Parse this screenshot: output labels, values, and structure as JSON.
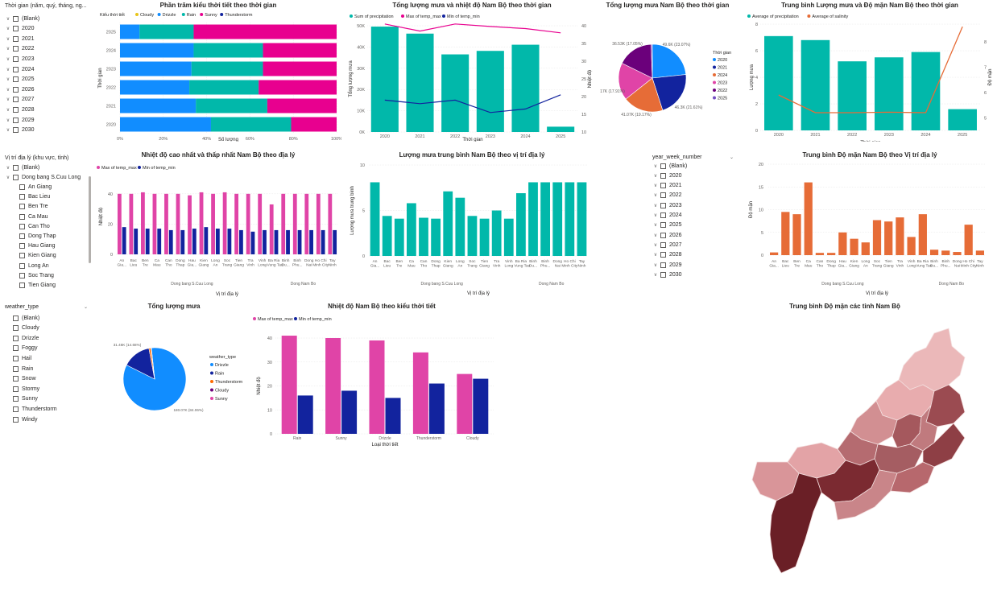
{
  "slicers": {
    "time": {
      "title": "Thời gian (năm, quý, tháng, ng...",
      "items": [
        "(Blank)",
        "2020",
        "2021",
        "2022",
        "2023",
        "2024",
        "2025",
        "2026",
        "2027",
        "2028",
        "2029",
        "2030"
      ]
    },
    "region": {
      "title": "Vị trí địa lý (khu vực, tỉnh)",
      "items": [
        "(Blank)",
        "Dong bang S.Cuu Long",
        "An Giang",
        "Bac Lieu",
        "Ben Tre",
        "Ca Mau",
        "Can Tho",
        "Dong Thap",
        "Hau Giang",
        "Kien Giang",
        "Long An",
        "Soc Trang",
        "Tien Giang"
      ]
    },
    "weather": {
      "title": "weather_type",
      "items": [
        "(Blank)",
        "Cloudy",
        "Drizzle",
        "Foggy",
        "Hail",
        "Rain",
        "Snow",
        "Stormy",
        "Sunny",
        "Thunderstorm",
        "Windy"
      ]
    },
    "week": {
      "title": "year_week_number",
      "items": [
        "(Blank)",
        "2020",
        "2021",
        "2022",
        "2023",
        "2024",
        "2025",
        "2026",
        "2027",
        "2028",
        "2029",
        "2030"
      ]
    }
  },
  "colors": {
    "teal": "#01b8aa",
    "navy": "#12239e",
    "magenta": "#e8008f",
    "pink": "#e044a7",
    "orange": "#e66c37",
    "blue": "#118dff",
    "purple": "#6b007b",
    "darkorange": "#ff6a00"
  },
  "charts": {
    "c1": {
      "title": "Phần trăm kiểu thời tiết theo thời gian",
      "legend_title": "Kiểu thời tiết",
      "series": [
        "Cloudy",
        "Drizzle",
        "Rain",
        "Sunny",
        "Thunderstorm"
      ],
      "xlabel": "Số lượng",
      "ylabel": "Thời gian",
      "ticks": [
        "0%",
        "20%",
        "40%",
        "60%",
        "80%",
        "100%"
      ]
    },
    "c2": {
      "title": "Tổng lượng mưa và nhiệt độ Nam Bộ theo thời gian",
      "legend": [
        "Sum of precipitation",
        "Max of temp_max",
        "Min of temp_min"
      ],
      "xlabel": "Thời gian",
      "ylabel": "Tổng lượng mưa",
      "y2label": "Nhiệt độ",
      "yticks": [
        "0K",
        "10K",
        "20K",
        "30K",
        "40K",
        "50K"
      ],
      "y2ticks": [
        "10",
        "15",
        "20",
        "25",
        "30",
        "35",
        "40"
      ]
    },
    "c3": {
      "title": "Tổng lượng mưa Nam Bộ theo thời gian",
      "legend_title": "Thời gian",
      "legend": [
        "2020",
        "2021",
        "2024",
        "2023",
        "2022",
        "2025"
      ],
      "labels": [
        "36.53K (17.05%)",
        "49.6K (23.07%)",
        "38.17K (17.91%)",
        "41.07K (19.17%)",
        "46.3K (21.61%)"
      ]
    },
    "c4": {
      "title": "Trung bình Lượng mưa và Độ mặn Nam Bộ theo thời gian",
      "legend": [
        "Average of precipitation",
        "Average of salinity"
      ],
      "xlabel": "Thời gian",
      "ylabel": "Lượng mưa",
      "y2label": "Độ mặn",
      "yticks": [
        "0",
        "2",
        "4",
        "6",
        "8"
      ],
      "y2ticks": [
        "5",
        "6",
        "7",
        "8"
      ]
    },
    "c5": {
      "title": "Nhiệt độ cao nhất và thấp nhất Nam Bộ theo địa lý",
      "legend": [
        "Max of temp_max",
        "Min of temp_min"
      ],
      "xlabel": "Vị trí địa lý",
      "ylabel": "Nhiệt độ",
      "yticks": [
        "0",
        "20",
        "40"
      ],
      "groups": [
        "Dong bang S.Cuu Long",
        "Dong Nam Bo"
      ]
    },
    "c6": {
      "title": "Lượng mưa trung bình Nam Bộ theo vị trí địa lý",
      "xlabel": "Vị trí địa lý",
      "ylabel": "Lượng mưa trung bình",
      "yticks": [
        "0",
        "5",
        "10"
      ],
      "groups": [
        "Dong bang S.Cuu Long",
        "Dong Nam Bo"
      ]
    },
    "c7": {
      "title": "Trung bình Độ mặn Nam Bộ theo Vị trí địa lý",
      "xlabel": "Vị trí địa lý",
      "ylabel": "Độ mặn",
      "yticks": [
        "0",
        "5",
        "10",
        "15",
        "20"
      ],
      "groups": [
        "Dong bang S.Cuu Long",
        "Dong Nam Bo"
      ]
    },
    "c8": {
      "title": "Tổng lượng mưa",
      "legend_title": "weather_type",
      "legend": [
        "Drizzle",
        "Rain",
        "Thunderstorm",
        "Cloudy",
        "Sunny"
      ],
      "labels": [
        "31.46K (14.68%)",
        "180.07K (84.06%)"
      ]
    },
    "c9": {
      "title": "Nhiệt độ Nam Bộ theo kiểu thời tiết",
      "legend": [
        "Max of temp_max",
        "Min of temp_min"
      ],
      "xlabel": "Loại thời tiết",
      "ylabel": "Nhiệt độ",
      "yticks": [
        "0",
        "10",
        "20",
        "30",
        "40"
      ]
    },
    "c10": {
      "title": "Trung bình Độ mặn các tỉnh Nam Bộ"
    }
  },
  "chart_data": [
    {
      "type": "bar",
      "id": "c1",
      "stacked": "percent",
      "orientation": "horizontal",
      "categories": [
        "2025",
        "2024",
        "2023",
        "2022",
        "2021",
        "2020"
      ],
      "series": [
        {
          "name": "Cloudy",
          "values": [
            0,
            0,
            0,
            0,
            0,
            0
          ]
        },
        {
          "name": "Drizzle",
          "values": [
            9,
            34,
            33,
            32,
            35,
            42
          ]
        },
        {
          "name": "Rain",
          "values": [
            25,
            32,
            33,
            32,
            33,
            37
          ]
        },
        {
          "name": "Sunny",
          "values": [
            66,
            34,
            34,
            36,
            32,
            21
          ]
        },
        {
          "name": "Thunderstorm",
          "values": [
            0,
            0,
            0,
            0,
            0,
            0
          ]
        }
      ]
    },
    {
      "type": "bar",
      "id": "c2",
      "categories": [
        "2020",
        "2021",
        "2022",
        "2023",
        "2024",
        "2025"
      ],
      "series": [
        {
          "name": "Sum of precipitation",
          "values": [
            49600,
            46300,
            36530,
            38170,
            41070,
            2500
          ],
          "kind": "bar"
        },
        {
          "name": "Max of temp_max",
          "values": [
            40.5,
            38.5,
            40.5,
            39.8,
            39.2,
            38
          ],
          "kind": "line",
          "axis": "y2"
        },
        {
          "name": "Min of temp_min",
          "values": [
            19,
            18,
            19,
            15.5,
            16.5,
            20.5
          ],
          "kind": "line",
          "axis": "y2"
        }
      ],
      "ylim": [
        0,
        50000
      ],
      "y2lim": [
        10,
        40
      ]
    },
    {
      "type": "pie",
      "id": "c3",
      "categories": [
        "2020",
        "2021",
        "2024",
        "2023",
        "2022",
        "2025"
      ],
      "values": [
        49.6,
        46.3,
        41.07,
        38.17,
        36.53,
        1.2
      ]
    },
    {
      "type": "bar",
      "id": "c4",
      "categories": [
        "2020",
        "2021",
        "2022",
        "2023",
        "2024",
        "2025"
      ],
      "series": [
        {
          "name": "Average of precipitation",
          "values": [
            7.1,
            6.8,
            5.2,
            5.5,
            5.9,
            1.6
          ],
          "kind": "bar"
        },
        {
          "name": "Average of salinity",
          "values": [
            5.9,
            5.2,
            5.2,
            5.22,
            5.2,
            8.6
          ],
          "kind": "line",
          "axis": "y2"
        }
      ],
      "ylim": [
        0,
        8
      ],
      "y2lim": [
        4.5,
        8.7
      ]
    },
    {
      "type": "bar",
      "id": "c5",
      "categories": [
        "An Gia...",
        "Bac Lieu",
        "Ben Tre",
        "Ca Mau",
        "Can Tho",
        "Dong Thap",
        "Hau Gia...",
        "Kien Giang",
        "Long An",
        "Soc Trang",
        "Tien Giang",
        "Tra Vinh",
        "Vinh Long",
        "Ba Ria - Vung Tau",
        "Binh Du...",
        "Binh Phu...",
        "Dong Nai",
        "Ho Chi Minh City",
        "Tay Ninh"
      ],
      "series": [
        {
          "name": "Max of temp_max",
          "values": [
            40,
            40,
            41,
            40,
            40,
            40,
            39,
            41,
            40,
            41,
            40,
            40,
            40,
            33,
            40,
            40,
            40,
            40,
            40
          ]
        },
        {
          "name": "Min of temp_min",
          "values": [
            18,
            17,
            17,
            17,
            16,
            16,
            17,
            18,
            17,
            17,
            16,
            15,
            16,
            16,
            16,
            16,
            16,
            16,
            16
          ]
        }
      ],
      "ylim": [
        0,
        50
      ]
    },
    {
      "type": "bar",
      "id": "c6",
      "categories": [
        "An Gia...",
        "Bac Lieu",
        "Ben Tre",
        "Ca Mau",
        "Can Tho",
        "Dong Thap",
        "Kien Giang",
        "Long An",
        "Soc Trang",
        "Tien Giang",
        "Tra Vinh",
        "Vinh Long",
        "Ba Ria - Vung Tau",
        "Binh Du...",
        "Binh Phu...",
        "Dong Nai",
        "Ho Chi Minh City",
        "Tay Ninh"
      ],
      "values": [
        8.1,
        4.4,
        4.1,
        5.8,
        4.2,
        4.1,
        7.1,
        6.4,
        4.4,
        4.1,
        5.0,
        4.1,
        6.9,
        8.1,
        8.1,
        8.1,
        8.1,
        8.1
      ],
      "ylim": [
        0,
        10
      ]
    },
    {
      "type": "bar",
      "id": "c7",
      "categories": [
        "An Giang",
        "Bac Lieu",
        "Ben Tre",
        "Ca Mau",
        "Can Tho",
        "Dong Thap",
        "Hau Giang",
        "Kien Giang",
        "Long An",
        "Soc Trang",
        "Tien Giang",
        "Tra Vinh",
        "Vinh Long",
        "Ba Ria - Vung Tau",
        "Binh Duong",
        "Binh Phuoc",
        "Dong Nai",
        "Ho Chi Minh City",
        "Tay Ninh"
      ],
      "values": [
        0.6,
        9.5,
        9.0,
        16.0,
        0.5,
        0.5,
        5.0,
        3.6,
        2.8,
        7.7,
        7.4,
        8.3,
        4.0,
        9.0,
        1.2,
        1.0,
        0.7,
        6.7,
        1.0
      ],
      "ylim": [
        0,
        20
      ]
    },
    {
      "type": "pie",
      "id": "c8",
      "categories": [
        "Drizzle",
        "Rain",
        "Thunderstorm",
        "Cloudy",
        "Sunny"
      ],
      "values": [
        180.07,
        31.46,
        2.2,
        0.4,
        0.1
      ]
    },
    {
      "type": "bar",
      "id": "c9",
      "categories": [
        "Rain",
        "Sunny",
        "Drizzle",
        "Thunderstorm",
        "Cloudy"
      ],
      "series": [
        {
          "name": "Max of temp_max",
          "values": [
            41,
            40,
            39,
            34,
            25
          ]
        },
        {
          "name": "Min of temp_min",
          "values": [
            16,
            18,
            15,
            21,
            23
          ]
        }
      ],
      "ylim": [
        0,
        40
      ]
    }
  ],
  "map": {
    "regions": [
      {
        "name": "r1",
        "fill": "#ebb8b9"
      },
      {
        "name": "r2",
        "fill": "#e8acae"
      },
      {
        "name": "r3",
        "fill": "#d28f92"
      },
      {
        "name": "r4",
        "fill": "#a5585d"
      },
      {
        "name": "r5",
        "fill": "#9b4b51"
      },
      {
        "name": "r6",
        "fill": "#c07a7e"
      },
      {
        "name": "r7",
        "fill": "#b56b70"
      },
      {
        "name": "r8",
        "fill": "#e3a3a6"
      },
      {
        "name": "r9",
        "fill": "#d99599"
      },
      {
        "name": "r10",
        "fill": "#a55d62"
      },
      {
        "name": "r11",
        "fill": "#8e3f45"
      },
      {
        "name": "r12",
        "fill": "#7b2a31"
      },
      {
        "name": "r13",
        "fill": "#6a1f26"
      },
      {
        "name": "r14",
        "fill": "#c98589"
      },
      {
        "name": "r15",
        "fill": "#b7686d"
      }
    ]
  }
}
